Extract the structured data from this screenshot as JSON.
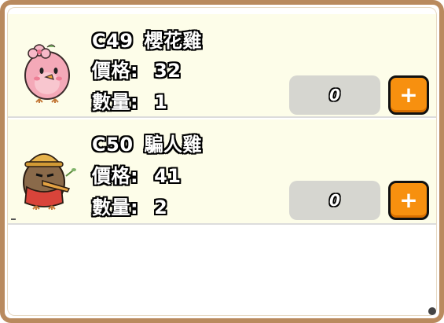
{
  "items": [
    {
      "code": "C49",
      "name": "櫻花雞",
      "price_label": "價格:",
      "price": "32",
      "qty_label": "數量:",
      "qty": "1",
      "count": "0",
      "add_label": "+",
      "icon": "sakura-chicken-icon",
      "color": "#f2a6b5"
    },
    {
      "code": "C50",
      "name": "騙人雞",
      "price_label": "價格:",
      "price": "41",
      "qty_label": "數量:",
      "qty": "2",
      "count": "0",
      "add_label": "+",
      "icon": "liar-chicken-icon",
      "color": "#8a6a4a"
    }
  ],
  "colors": {
    "frame": "#b98a5e",
    "row_bg": "#fdfde9",
    "button": "#f7900f",
    "count_box": "#d6d6d0"
  }
}
